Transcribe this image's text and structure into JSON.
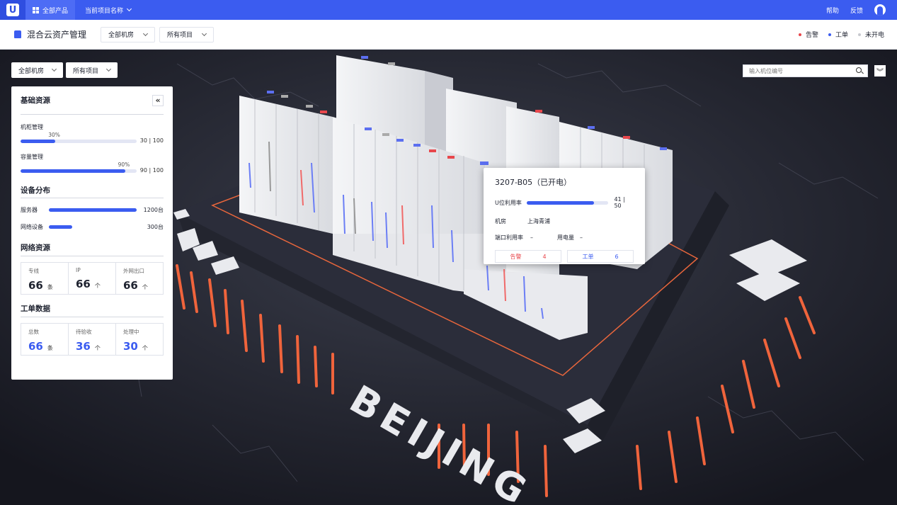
{
  "nav": {
    "logo": "U",
    "products_label": "全部产品",
    "project_label": "当前项目名称",
    "help_label": "帮助",
    "feedback_label": "反馈"
  },
  "header": {
    "title": "混合云资产管理",
    "room_select": "全部机房",
    "project_select": "所有项目",
    "legend": [
      {
        "label": "告警",
        "color": "#e8474c"
      },
      {
        "label": "工单",
        "color": "#3b5cf0"
      },
      {
        "label": "未开电",
        "color": "#c7c9cf"
      }
    ]
  },
  "scene": {
    "room_select": "全部机房",
    "project_select": "所有项目",
    "search_placeholder": "输入机位编号",
    "floor_text": "BEIJING"
  },
  "panel": {
    "basic": {
      "title": "基础资源",
      "collapse": "«",
      "bars": [
        {
          "label": "机柜管理",
          "percent_label": "30%",
          "fraction": 0.3,
          "value": "30 | 100"
        },
        {
          "label": "容量管理",
          "percent_label": "90%",
          "fraction": 0.9,
          "value": "90 | 100"
        }
      ]
    },
    "distribution": {
      "title": "设备分布",
      "rows": [
        {
          "label": "服务器",
          "fraction": 1.0,
          "value": "1200台"
        },
        {
          "label": "网络设备",
          "fraction": 0.27,
          "value": "300台"
        }
      ]
    },
    "network": {
      "title": "网络资源",
      "stats": [
        {
          "label": "专线",
          "value": "66",
          "unit": "条"
        },
        {
          "label": "IP",
          "value": "66",
          "unit": "个"
        },
        {
          "label": "外网出口",
          "value": "66",
          "unit": "个"
        }
      ]
    },
    "tickets": {
      "title": "工单数据",
      "stats": [
        {
          "label": "总数",
          "value": "66",
          "unit": "条"
        },
        {
          "label": "待验收",
          "value": "36",
          "unit": "个"
        },
        {
          "label": "处理中",
          "value": "30",
          "unit": "个"
        }
      ]
    }
  },
  "tooltip": {
    "title": "3207-B05（已开电）",
    "u_label": "U位利用率",
    "u_fraction": 0.82,
    "u_value": "41 | 50",
    "room_label": "机房",
    "room_value": "上海青浦",
    "port_label": "端口利用率",
    "port_value": "–",
    "power_label": "用电量",
    "power_value": "–",
    "alarm_label": "告警",
    "alarm_count": "4",
    "ticket_label": "工单",
    "ticket_count": "6"
  },
  "colors": {
    "accent": "#3b5cf0",
    "alarm": "#e8474c",
    "stripe": "#f0643c"
  }
}
